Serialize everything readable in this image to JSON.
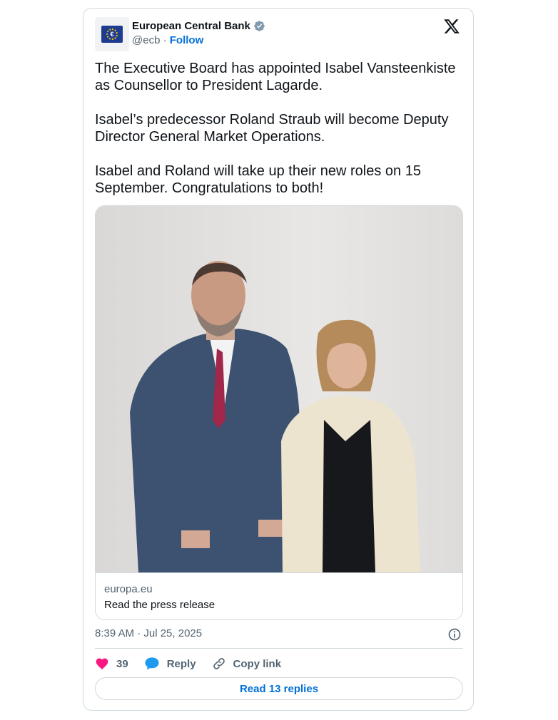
{
  "account": {
    "name": "European Central Bank",
    "handle": "@ecb",
    "separator": "·",
    "follow_label": "Follow",
    "logo_symbol": "€"
  },
  "tweet": {
    "paragraphs": [
      "The Executive Board has appointed Isabel Vansteenkiste as Counsellor to President Lagarde.",
      "Isabel’s predecessor Roland Straub will become Deputy Director General Market Operations.",
      "Isabel and Roland will take up their new roles on 15 September. Congratulations to both!"
    ]
  },
  "link_card": {
    "domain": "europa.eu",
    "title": "Read the press release"
  },
  "meta": {
    "timestamp": "8:39 AM · Jul 25, 2025"
  },
  "actions": {
    "like_count": "39",
    "reply_label": "Reply",
    "copy_link_label": "Copy link"
  },
  "read_replies_label": "Read 13 replies",
  "colors": {
    "accent": "#006fd6",
    "like": "#f91880",
    "reply": "#1d9bf0",
    "verified": "#829aab",
    "border": "#cfd9de",
    "muted": "#536471"
  },
  "icons": [
    "verified-badge-icon",
    "x-logo-icon",
    "info-icon",
    "heart-icon",
    "reply-bubble-icon",
    "link-icon"
  ]
}
